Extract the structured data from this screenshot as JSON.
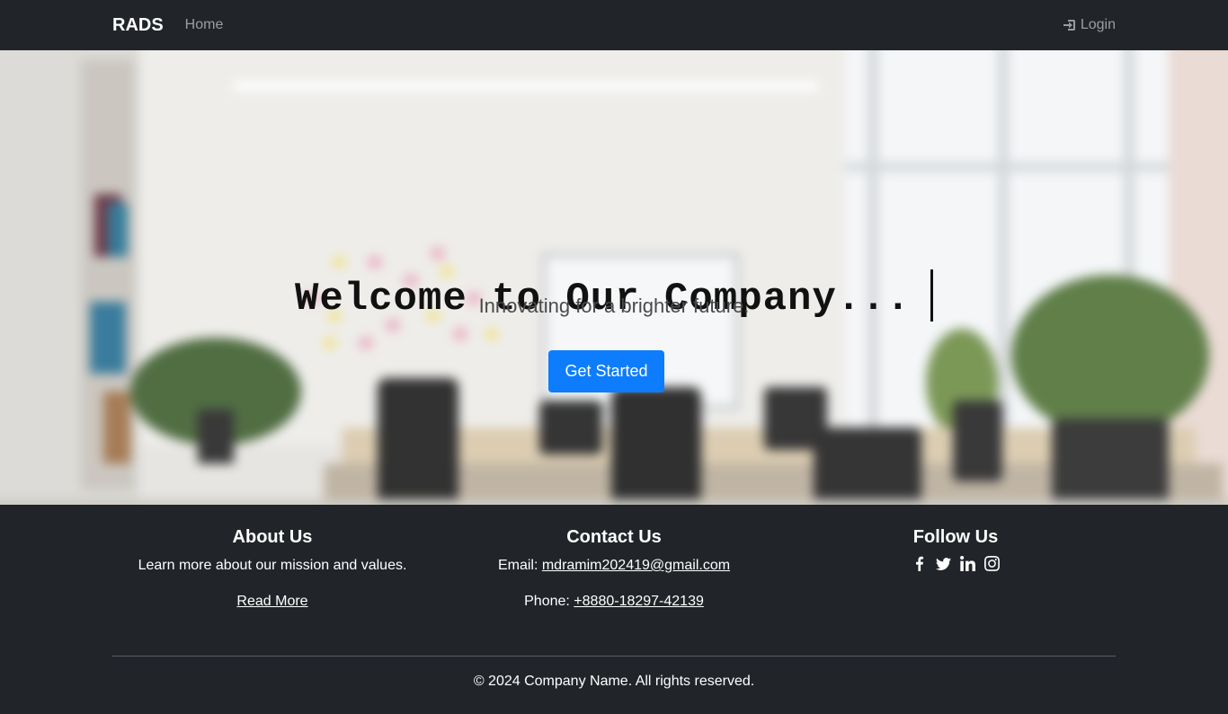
{
  "navbar": {
    "brand": "RADS",
    "home_label": "Home",
    "login_label": "Login",
    "login_icon": "sign-in-icon"
  },
  "hero": {
    "title": "Welcome to Our Company...",
    "subtitle": "Innovating for a brighter future.",
    "button_label": "Get Started",
    "button_color": "#0d7dfd"
  },
  "footer": {
    "about": {
      "heading": "About Us",
      "text": "Learn more about our mission and values.",
      "link": "Read More"
    },
    "contact": {
      "heading": "Contact Us",
      "email_label": "Email:",
      "email": "mdramim202419@gmail.com",
      "phone_label": "Phone:",
      "phone": "+8880-18297-42139"
    },
    "follow": {
      "heading": "Follow Us",
      "icons": [
        "facebook-icon",
        "twitter-icon",
        "linkedin-icon",
        "instagram-icon"
      ]
    },
    "copyright": "© 2024 Company Name. All rights reserved."
  },
  "colors": {
    "dark": "#212529",
    "accent": "#0d7dfd"
  }
}
